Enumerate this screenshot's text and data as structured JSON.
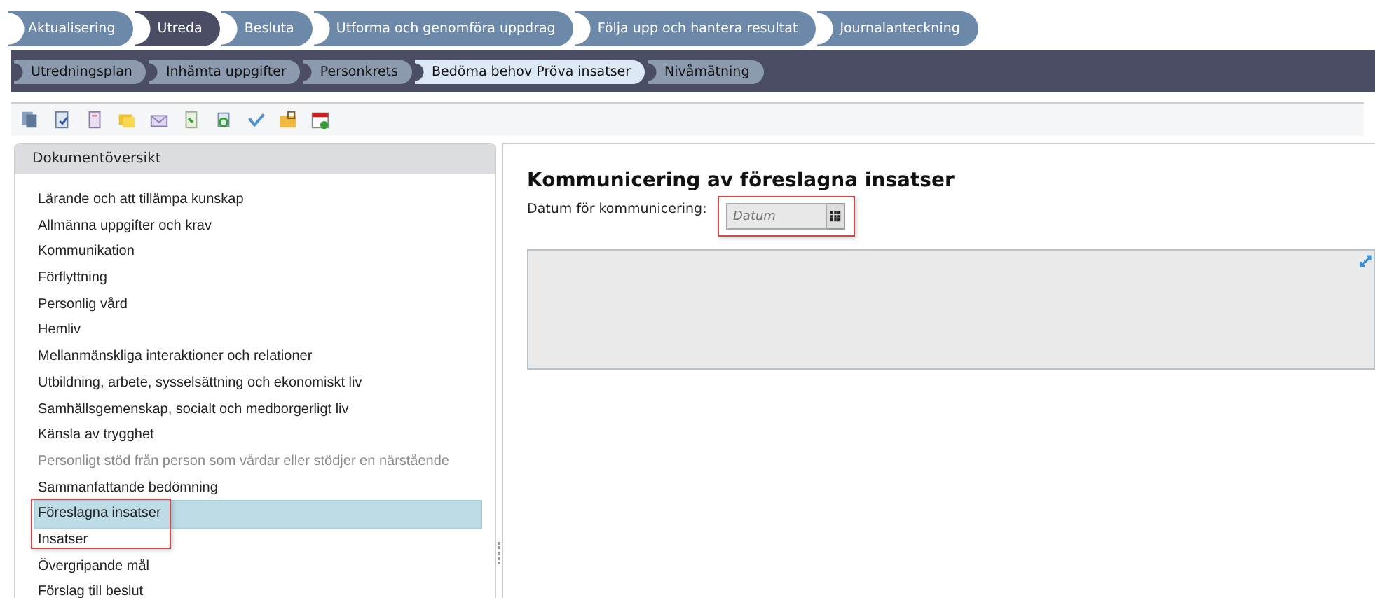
{
  "tabs": [
    {
      "label": "Aktualisering",
      "selected": false
    },
    {
      "label": "Utreda",
      "selected": true
    },
    {
      "label": "Besluta",
      "selected": false
    },
    {
      "label": "Utforma och genomföra uppdrag",
      "selected": false
    },
    {
      "label": "Följa upp och hantera resultat",
      "selected": false
    },
    {
      "label": "Journalanteckning",
      "selected": false
    }
  ],
  "subtabs": [
    {
      "label": "Utredningsplan",
      "selected": false
    },
    {
      "label": "Inhämta uppgifter",
      "selected": false
    },
    {
      "label": "Personkrets",
      "selected": false
    },
    {
      "label": "Bedöma behov Pröva insatser",
      "selected": true
    },
    {
      "label": "Nivåmätning",
      "selected": false
    }
  ],
  "sidebar": {
    "title": "Dokumentöversikt",
    "items": [
      {
        "label": "Lärande och att tillämpa kunskap",
        "selected": false,
        "disabled": false
      },
      {
        "label": "Allmänna uppgifter och krav",
        "selected": false,
        "disabled": false
      },
      {
        "label": "Kommunikation",
        "selected": false,
        "disabled": false
      },
      {
        "label": "Förflyttning",
        "selected": false,
        "disabled": false
      },
      {
        "label": "Personlig vård",
        "selected": false,
        "disabled": false
      },
      {
        "label": "Hemliv",
        "selected": false,
        "disabled": false
      },
      {
        "label": "Mellanmänskliga interaktioner och relationer",
        "selected": false,
        "disabled": false
      },
      {
        "label": "Utbildning, arbete, sysselsättning och ekonomiskt liv",
        "selected": false,
        "disabled": false
      },
      {
        "label": "Samhällsgemenskap, socialt och medborgerligt liv",
        "selected": false,
        "disabled": false
      },
      {
        "label": "Känsla av trygghet",
        "selected": false,
        "disabled": false
      },
      {
        "label": "Personligt stöd från person som vårdar eller stödjer en närstående",
        "selected": false,
        "disabled": true
      },
      {
        "label": "Sammanfattande bedömning",
        "selected": false,
        "disabled": false
      },
      {
        "label": "Föreslagna insatser",
        "selected": true,
        "disabled": false
      },
      {
        "label": "Insatser",
        "selected": false,
        "disabled": false
      },
      {
        "label": "Övergripande mål",
        "selected": false,
        "disabled": false
      },
      {
        "label": "Förslag till beslut",
        "selected": false,
        "disabled": false
      }
    ]
  },
  "content": {
    "heading": "Kommunicering av föreslagna insatser",
    "date_label": "Datum för kommunicering:",
    "date_field": {
      "placeholder": "Datum"
    }
  }
}
